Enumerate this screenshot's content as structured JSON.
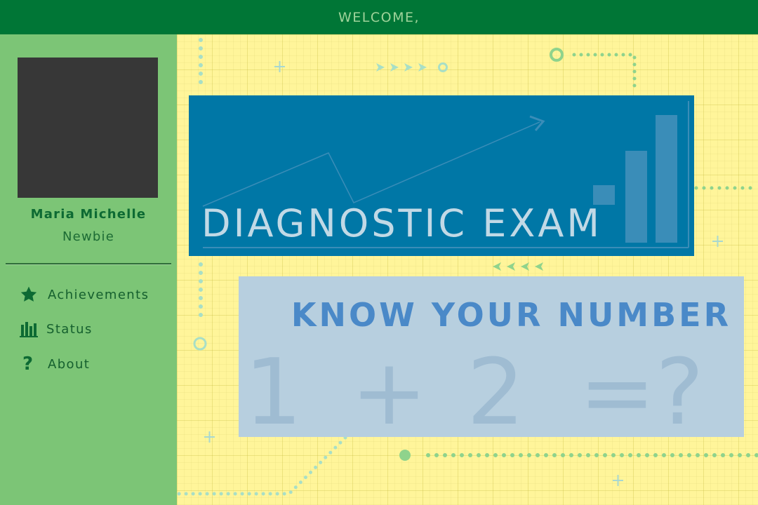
{
  "header": {
    "welcome": "WELCOME,"
  },
  "sidebar": {
    "user": {
      "name": "Maria Michelle",
      "rank": "Newbie"
    },
    "items": [
      {
        "label": "Achievements",
        "icon": "star-icon"
      },
      {
        "label": "Status",
        "icon": "bar-chart-icon"
      },
      {
        "label": "About",
        "icon": "question-icon"
      }
    ]
  },
  "main": {
    "banner_title": "DIAGNOSTIC EXAM",
    "panel_title": "KNOW YOUR NUMBER",
    "equation": [
      "1",
      "+",
      "2",
      "=?"
    ]
  },
  "colors": {
    "header_bg": "#007636",
    "sidebar_bg": "#7cc576",
    "banner_bg": "#0077a6",
    "panel_bg": "#b7cfdf",
    "panel_title": "#4a89c8",
    "background": "#fff59a"
  }
}
